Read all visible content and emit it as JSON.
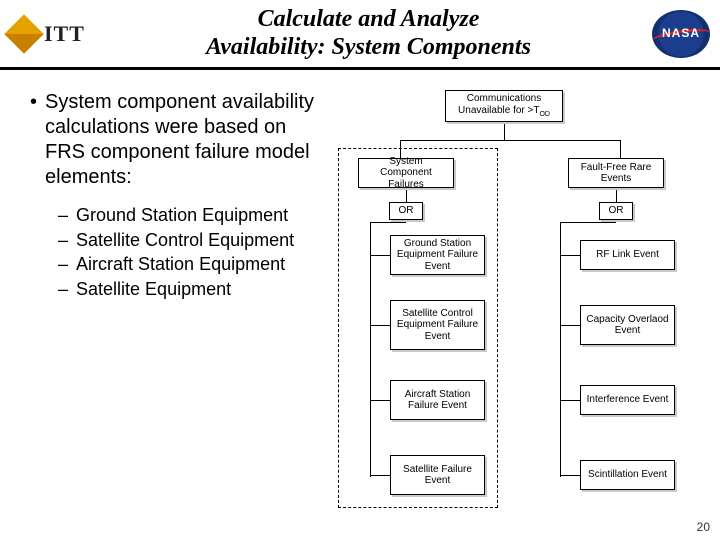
{
  "header": {
    "logo_left_text": "ITT",
    "title_line1": "Calculate and Analyze",
    "title_line2": "Availability: System Components",
    "logo_right_text": "NASA"
  },
  "bullet": {
    "main": "System component availability calculations were based on FRS component failure model elements:",
    "subs": [
      "Ground Station Equipment",
      "Satellite Control Equipment",
      "Aircraft Station Equipment",
      "Satellite Equipment"
    ]
  },
  "diagram": {
    "root_l1": "Communications",
    "root_l2": "Unavailable for >T",
    "root_sub": "OD",
    "left_branch": "System Component Failures",
    "right_branch": "Fault-Free Rare Events",
    "or_label": "OR",
    "left_children": [
      "Ground Station Equipment Failure Event",
      "Satellite Control Equipment Failure Event",
      "Aircraft Station Failure Event",
      "Satellite Failure Event"
    ],
    "right_children": [
      "RF Link Event",
      "Capacity Overlaod Event",
      "Interference Event",
      "Scintillation Event"
    ]
  },
  "page_number": "20"
}
